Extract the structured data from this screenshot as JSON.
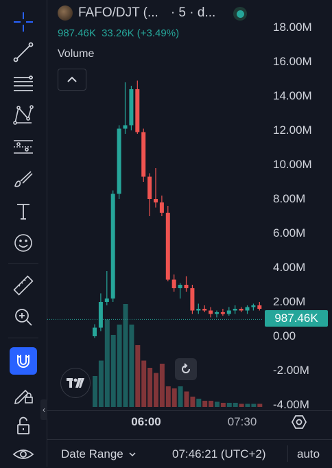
{
  "legend": {
    "symbol": "FAFO/DJT (...",
    "interval": "· 5 · d...",
    "price": "987.46K",
    "change": "33.26K",
    "change_pct": "(+3.49%)",
    "volume_label": "Volume"
  },
  "price_axis": {
    "ticks": [
      "18.00M",
      "16.00M",
      "14.00M",
      "12.00M",
      "10.00M",
      "8.00M",
      "6.00M",
      "4.00M",
      "2.00M",
      "0.00",
      "-2.00M",
      "-4.00M"
    ],
    "current_tag": "987.46K"
  },
  "time_axis": {
    "ticks": [
      {
        "label": "06:00",
        "bold": true
      },
      {
        "label": "07:30",
        "bold": false
      }
    ]
  },
  "bottom_bar": {
    "date_range": "Date Range",
    "clock": "07:46:21 (UTC+2)",
    "auto": "auto"
  },
  "colors": {
    "up": "#26a69a",
    "down": "#ef5350",
    "accent": "#2962ff",
    "background": "#131722"
  },
  "tools": [
    "crosshair-icon",
    "trend-line-icon",
    "fib-retracement-icon",
    "pattern-icon",
    "prediction-icon",
    "brush-icon",
    "text-icon",
    "emoji-icon",
    "ruler-icon",
    "zoom-in-icon",
    "magnet-icon",
    "lock-drawing-icon",
    "unlock-icon",
    "eye-icon"
  ],
  "chart_data": {
    "type": "candlestick",
    "ylim": [
      -4000000,
      18000000
    ],
    "current_price": 987460,
    "candles": [
      {
        "o": 0.0,
        "h": 0.7,
        "l": -0.1,
        "c": 0.5
      },
      {
        "o": 0.5,
        "h": 2.5,
        "l": 0.3,
        "c": 2.0
      },
      {
        "o": 2.0,
        "h": 3.8,
        "l": 1.8,
        "c": 2.2
      },
      {
        "o": 2.2,
        "h": 8.5,
        "l": 2.0,
        "c": 8.3
      },
      {
        "o": 8.3,
        "h": 12.3,
        "l": 8.0,
        "c": 12.1
      },
      {
        "o": 12.1,
        "h": 14.8,
        "l": 11.8,
        "c": 12.3
      },
      {
        "o": 12.3,
        "h": 14.6,
        "l": 12.0,
        "c": 14.4
      },
      {
        "o": 14.4,
        "h": 14.9,
        "l": 11.8,
        "c": 11.9
      },
      {
        "o": 11.9,
        "h": 12.1,
        "l": 9.0,
        "c": 9.3
      },
      {
        "o": 9.3,
        "h": 9.5,
        "l": 7.0,
        "c": 8.0
      },
      {
        "o": 8.0,
        "h": 9.8,
        "l": 7.5,
        "c": 7.8
      },
      {
        "o": 7.8,
        "h": 8.2,
        "l": 7.0,
        "c": 7.2
      },
      {
        "o": 7.2,
        "h": 7.6,
        "l": 3.2,
        "c": 3.3
      },
      {
        "o": 3.3,
        "h": 3.6,
        "l": 2.6,
        "c": 2.8
      },
      {
        "o": 2.8,
        "h": 3.1,
        "l": 2.2,
        "c": 3.0
      },
      {
        "o": 3.0,
        "h": 3.5,
        "l": 2.6,
        "c": 2.8
      },
      {
        "o": 2.8,
        "h": 3.0,
        "l": 1.3,
        "c": 1.5
      },
      {
        "o": 1.5,
        "h": 1.9,
        "l": 1.3,
        "c": 1.6
      },
      {
        "o": 1.6,
        "h": 1.8,
        "l": 1.4,
        "c": 1.5
      },
      {
        "o": 1.5,
        "h": 1.7,
        "l": 1.1,
        "c": 1.3
      },
      {
        "o": 1.3,
        "h": 1.5,
        "l": 1.1,
        "c": 1.4
      },
      {
        "o": 1.4,
        "h": 1.6,
        "l": 1.2,
        "c": 1.3
      },
      {
        "o": 1.3,
        "h": 1.7,
        "l": 1.2,
        "c": 1.5
      },
      {
        "o": 1.5,
        "h": 1.8,
        "l": 1.3,
        "c": 1.6
      },
      {
        "o": 1.6,
        "h": 1.7,
        "l": 1.4,
        "c": 1.5
      },
      {
        "o": 1.5,
        "h": 1.8,
        "l": 1.3,
        "c": 1.7
      },
      {
        "o": 1.7,
        "h": 1.9,
        "l": 1.5,
        "c": 1.8
      },
      {
        "o": 1.8,
        "h": 2.0,
        "l": 1.5,
        "c": 1.6
      },
      {
        "o": 1.6,
        "h": 1.7,
        "l": 1.0,
        "c": 1.1
      },
      {
        "o": 1.1,
        "h": 1.2,
        "l": 0.9,
        "c": 1.0
      },
      {
        "o": 1.0,
        "h": 1.1,
        "l": 0.85,
        "c": 1.05
      },
      {
        "o": 1.05,
        "h": 1.1,
        "l": 0.9,
        "c": 0.95
      },
      {
        "o": 0.95,
        "h": 1.0,
        "l": 0.85,
        "c": 0.9
      },
      {
        "o": 0.9,
        "h": 1.0,
        "l": 0.85,
        "c": 0.95
      },
      {
        "o": 0.95,
        "h": 1.0,
        "l": 0.9,
        "c": 0.98
      }
    ],
    "volume": [
      0.3,
      0.45,
      0.85,
      0.7,
      0.8,
      1.0,
      0.8,
      0.6,
      0.45,
      0.38,
      0.33,
      0.42,
      0.2,
      0.18,
      0.2,
      0.15,
      0.1,
      0.08,
      0.06,
      0.06,
      0.05,
      0.04,
      0.04,
      0.04,
      0.03,
      0.03,
      0.03,
      0.03,
      0.02,
      0.02,
      0.02,
      0.02,
      0.02,
      0.02,
      0.02
    ]
  }
}
